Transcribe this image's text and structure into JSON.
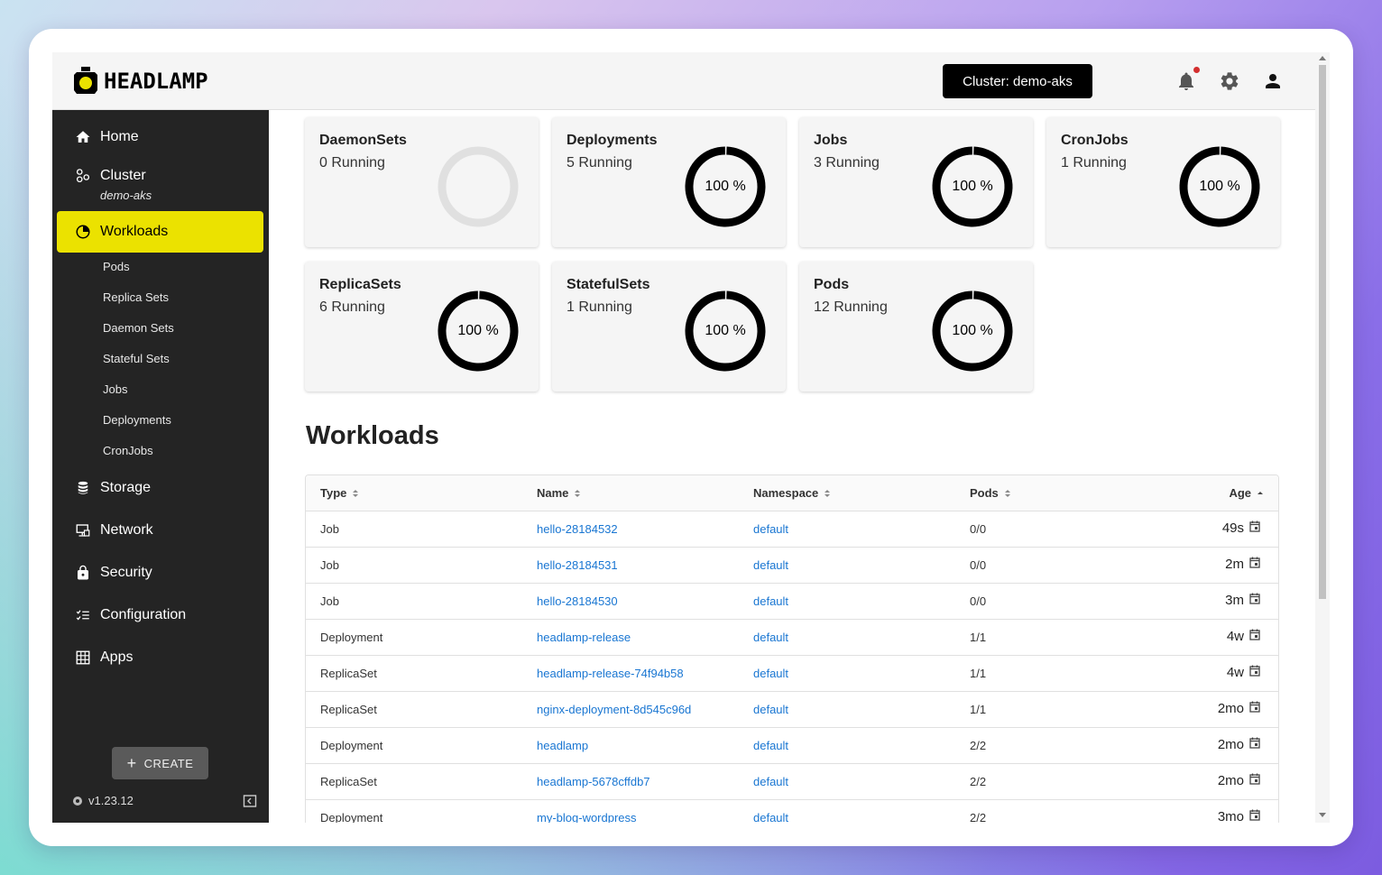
{
  "brand": {
    "name": "HEADLAMP"
  },
  "topbar": {
    "cluster_button": "Cluster: demo-aks"
  },
  "sidebar": {
    "items": [
      {
        "label": "Home"
      },
      {
        "label": "Cluster",
        "sub": "demo-aks"
      },
      {
        "label": "Workloads"
      },
      {
        "label": "Storage"
      },
      {
        "label": "Network"
      },
      {
        "label": "Security"
      },
      {
        "label": "Configuration"
      },
      {
        "label": "Apps"
      }
    ],
    "workload_subitems": [
      "Pods",
      "Replica Sets",
      "Daemon Sets",
      "Stateful Sets",
      "Jobs",
      "Deployments",
      "CronJobs"
    ],
    "create_label": "CREATE",
    "version": "v1.23.12"
  },
  "cards": [
    {
      "title": "DaemonSets",
      "status": "0 Running",
      "percent_label": "",
      "fill": 0
    },
    {
      "title": "Deployments",
      "status": "5 Running",
      "percent_label": "100 %",
      "fill": 1
    },
    {
      "title": "Jobs",
      "status": "3 Running",
      "percent_label": "100 %",
      "fill": 1
    },
    {
      "title": "CronJobs",
      "status": "1 Running",
      "percent_label": "100 %",
      "fill": 1
    },
    {
      "title": "ReplicaSets",
      "status": "6 Running",
      "percent_label": "100 %",
      "fill": 1
    },
    {
      "title": "StatefulSets",
      "status": "1 Running",
      "percent_label": "100 %",
      "fill": 1
    },
    {
      "title": "Pods",
      "status": "12 Running",
      "percent_label": "100 %",
      "fill": 1
    }
  ],
  "workloads": {
    "title": "Workloads",
    "columns": [
      "Type",
      "Name",
      "Namespace",
      "Pods",
      "Age"
    ],
    "rows": [
      {
        "type": "Job",
        "name": "hello-28184532",
        "namespace": "default",
        "pods": "0/0",
        "age": "49s"
      },
      {
        "type": "Job",
        "name": "hello-28184531",
        "namespace": "default",
        "pods": "0/0",
        "age": "2m"
      },
      {
        "type": "Job",
        "name": "hello-28184530",
        "namespace": "default",
        "pods": "0/0",
        "age": "3m"
      },
      {
        "type": "Deployment",
        "name": "headlamp-release",
        "namespace": "default",
        "pods": "1/1",
        "age": "4w"
      },
      {
        "type": "ReplicaSet",
        "name": "headlamp-release-74f94b58",
        "namespace": "default",
        "pods": "1/1",
        "age": "4w"
      },
      {
        "type": "ReplicaSet",
        "name": "nginx-deployment-8d545c96d",
        "namespace": "default",
        "pods": "1/1",
        "age": "2mo"
      },
      {
        "type": "Deployment",
        "name": "headlamp",
        "namespace": "default",
        "pods": "2/2",
        "age": "2mo"
      },
      {
        "type": "ReplicaSet",
        "name": "headlamp-5678cffdb7",
        "namespace": "default",
        "pods": "2/2",
        "age": "2mo"
      },
      {
        "type": "Deployment",
        "name": "my-blog-wordpress",
        "namespace": "default",
        "pods": "2/2",
        "age": "3mo"
      }
    ]
  },
  "colors": {
    "accent": "#ebe200",
    "sidebar": "#242424",
    "link": "#1976d2",
    "notification": "#d32f2f"
  }
}
